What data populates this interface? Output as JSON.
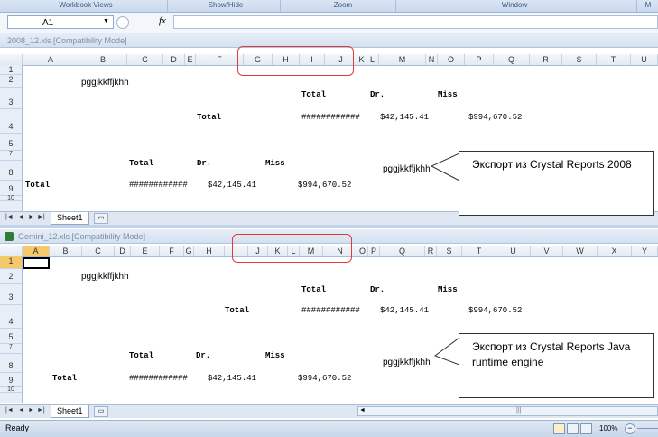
{
  "ribbon": {
    "groups": [
      "Workbook Views",
      "Show/Hide",
      "Zoom",
      "Window",
      "M"
    ]
  },
  "formula_bar": {
    "name_box": "A1",
    "fx": "fx",
    "formula": ""
  },
  "window1": {
    "title": "2008_12.xls  [Compatibility Mode]",
    "columns": [
      "A",
      "B",
      "C",
      "D",
      "E",
      "F",
      "G",
      "H",
      "I",
      "J",
      "K",
      "L",
      "M",
      "N",
      "O",
      "P",
      "Q",
      "R",
      "S",
      "T",
      "U"
    ],
    "rows": [
      "1",
      "2",
      "3",
      "4",
      "5",
      "7",
      "8",
      "9",
      "10"
    ],
    "cells": {
      "b2": "pggjkkffjkhh",
      "total_hdr": "Total",
      "dr_hdr": "Dr.",
      "miss_hdr": "Miss",
      "total_label": "Total",
      "hash": "############",
      "dr_val": "$42,145.41",
      "miss_val": "$994,670.52",
      "t2": "Total",
      "d2": "Dr.",
      "m2": "Miss",
      "pg2": "pggjkkffjkhh",
      "a9": "Total",
      "hash2": "############",
      "dr2": "$42,145.41",
      "miss2": "$994,670.52"
    },
    "sheet_tab": "Sheet1",
    "annotation": "Экспорт из Crystal Reports 2008"
  },
  "window2": {
    "title": "Gemini_12.xls  [Compatibility Mode]",
    "columns": [
      "A",
      "B",
      "C",
      "D",
      "E",
      "F",
      "G",
      "H",
      "I",
      "J",
      "K",
      "L",
      "M",
      "N",
      "O",
      "P",
      "Q",
      "R",
      "S",
      "T",
      "U",
      "V",
      "W",
      "X",
      "Y"
    ],
    "rows": [
      "1",
      "2",
      "3",
      "4",
      "5",
      "7",
      "8",
      "9",
      "10"
    ],
    "cells": {
      "b2": "pggjkkffjkhh",
      "total_hdr": "Total",
      "dr_hdr": "Dr.",
      "miss_hdr": "Miss",
      "total_label": "Total",
      "hash": "############",
      "dr_val": "$42,145.41",
      "miss_val": "$994,670.52",
      "t2": "Total",
      "d2": "Dr.",
      "m2": "Miss",
      "pg2": "pggjkkffjkhh",
      "a9": "Total",
      "hash2": "############",
      "dr2": "$42,145.41",
      "miss2": "$994,670.52"
    },
    "sheet_tab": "Sheet1",
    "annotation": "Экспорт из Crystal Reports Java runtime engine"
  },
  "status": {
    "ready": "Ready",
    "zoom": "100%"
  },
  "colors": {
    "accent": "#e03a3a",
    "header_bg": "#e3eaf4",
    "selected_cell": "#f5c96b"
  }
}
